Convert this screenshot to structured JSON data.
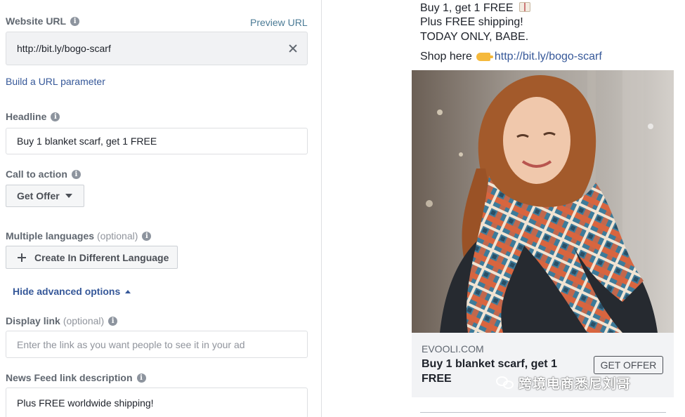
{
  "form": {
    "website_url": {
      "label": "Website URL",
      "preview_link": "Preview URL",
      "value": "http://bit.ly/bogo-scarf"
    },
    "build_url_link": "Build a URL parameter",
    "headline": {
      "label": "Headline",
      "value": "Buy 1 blanket scarf, get 1 FREE"
    },
    "call_to_action": {
      "label": "Call to action",
      "selected": "Get Offer"
    },
    "multiple_languages": {
      "label": "Multiple languages",
      "optional": "(optional)",
      "button": "Create In Different Language"
    },
    "advanced_toggle": "Hide advanced options",
    "display_link": {
      "label": "Display link",
      "optional": "(optional)",
      "placeholder": "Enter the link as you want people to see it in your ad"
    },
    "news_feed_description": {
      "label": "News Feed link description",
      "value": "Plus FREE worldwide shipping!"
    }
  },
  "preview": {
    "body_lines": [
      "Buy 1, get 1 FREE",
      "Plus FREE shipping!",
      "TODAY ONLY, BABE."
    ],
    "shop_prefix": "Shop here",
    "shop_link": "http://bit.ly/bogo-scarf",
    "domain": "EVOOLI.COM",
    "headline": "Buy 1 blanket scarf, get 1 FREE",
    "cta_button": "GET OFFER"
  },
  "watermark": {
    "text": "跨境电商悉尼刘哥"
  },
  "colors": {
    "link": "#365899",
    "label": "#606770",
    "panel_border": "#dddfe2",
    "footer_bg": "#f2f3f5"
  }
}
